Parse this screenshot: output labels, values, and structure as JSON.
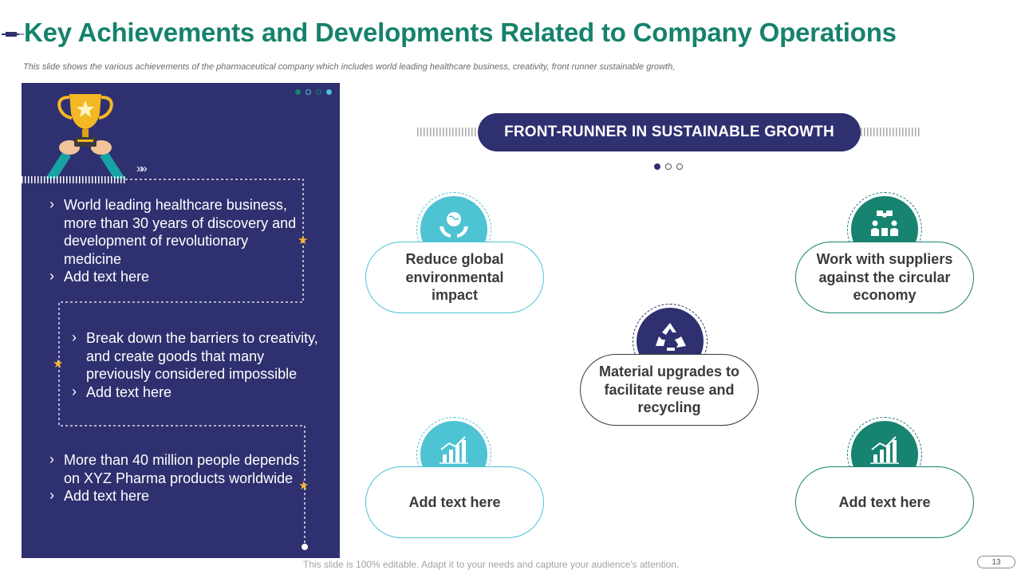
{
  "slide": {
    "title": "Key Achievements and Developments Related to Company Operations",
    "subtitle": "This slide shows the various achievements of the pharmaceutical company which includes world leading healthcare business, creativity, front runner sustainable growth,",
    "footer": "This slide is 100% editable. Adapt it to your needs and capture your audience's attention.",
    "page_number": "13"
  },
  "left_panel": {
    "chevrons": "»»",
    "groups": [
      {
        "items": [
          "World leading healthcare business, more than  30 years of discovery and development of revolutionary medicine",
          "Add text here"
        ]
      },
      {
        "items": [
          "Break down the barriers to creativity, and create goods that many previously considered impossible",
          "Add text here"
        ]
      },
      {
        "items": [
          "More than 40 million people depends on XYZ Pharma products worldwide",
          "Add text here"
        ]
      }
    ],
    "star_glyph": "★"
  },
  "diagram": {
    "banner": "FRONT-RUNNER IN SUSTAINABLE GROWTH",
    "nodes": {
      "top_left": {
        "label": "Reduce global environmental impact",
        "icon": "globe-hands-icon"
      },
      "top_right": {
        "label": "Work with suppliers against the circular economy",
        "icon": "meeting-icon"
      },
      "center": {
        "label": "Material upgrades to facilitate reuse and recycling",
        "icon": "recycle-icon"
      },
      "bottom_left": {
        "label": "Add text here",
        "icon": "growth-chart-icon"
      },
      "bottom_right": {
        "label": "Add text here",
        "icon": "growth-chart-icon"
      }
    }
  },
  "colors": {
    "title_green": "#16826c",
    "navy": "#2f306f",
    "teal_light": "#4ec3d3",
    "teal_dark": "#178371",
    "star_gold": "#f2b632"
  }
}
